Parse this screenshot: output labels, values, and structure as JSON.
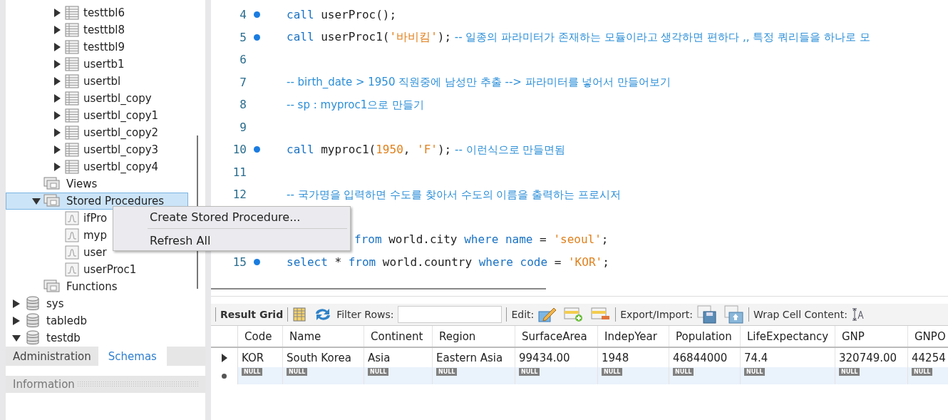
{
  "navigator": {
    "tables": [
      {
        "label": "testtbl6",
        "expanded": false
      },
      {
        "label": "testtbl8",
        "expanded": false
      },
      {
        "label": "testtbl9",
        "expanded": false
      },
      {
        "label": "usertb1",
        "expanded": false
      },
      {
        "label": "usertbl",
        "expanded": false
      },
      {
        "label": "usertbl_copy",
        "expanded": false
      },
      {
        "label": "usertbl_copy1",
        "expanded": false
      },
      {
        "label": "usertbl_copy2",
        "expanded": false
      },
      {
        "label": "usertbl_copy3",
        "expanded": false
      },
      {
        "label": "usertbl_copy4",
        "expanded": false
      }
    ],
    "objects": [
      {
        "label": "Views",
        "selected": false
      },
      {
        "label": "Stored Procedures",
        "selected": true,
        "expanded": true,
        "children": [
          {
            "label": "ifPro"
          },
          {
            "label": "myp"
          },
          {
            "label": "user"
          },
          {
            "label": "userProc1"
          }
        ]
      },
      {
        "label": "Functions",
        "selected": false
      }
    ],
    "databases": [
      {
        "label": "sys",
        "expanded": false
      },
      {
        "label": "tabledb",
        "expanded": false
      },
      {
        "label": "testdb",
        "expanded": true
      }
    ],
    "tabs": [
      {
        "label": "Administration",
        "selected": false
      },
      {
        "label": "Schemas",
        "selected": true
      }
    ],
    "info_header": "Information"
  },
  "context_menu": {
    "items": [
      "Create Stored Procedure...",
      "Refresh All"
    ]
  },
  "editor": {
    "lines": [
      {
        "number": "4",
        "marker": true,
        "tokens": [
          {
            "kind": "kw",
            "text": "call"
          },
          {
            "kind": "id",
            "text": " userProc();"
          }
        ]
      },
      {
        "number": "5",
        "marker": true,
        "tokens": [
          {
            "kind": "kw",
            "text": "call"
          },
          {
            "kind": "id",
            "text": " userProc1("
          },
          {
            "kind": "str",
            "text": "'바비킴'"
          },
          {
            "kind": "id",
            "text": ");"
          },
          {
            "kind": "cmt",
            "text": " -- 일종의 파라미터가 존재하는 모듈이라고 생각하면 편하다 ,, 특정 쿼리들을 하나로 모"
          }
        ]
      },
      {
        "number": "6",
        "marker": false
      },
      {
        "number": "7",
        "marker": false,
        "tokens": [
          {
            "kind": "cmt",
            "text": "-- birth_date > 1950 직원중에 남성만 추출  --> 파라미터를 넣어서 만들어보기"
          }
        ]
      },
      {
        "number": "8",
        "marker": false,
        "tokens": [
          {
            "kind": "cmt",
            "text": "-- sp : myproc1으로 만들기"
          }
        ]
      },
      {
        "number": "9",
        "marker": false
      },
      {
        "number": "10",
        "marker": true,
        "tokens": [
          {
            "kind": "kw",
            "text": "call"
          },
          {
            "kind": "id",
            "text": " myproc1("
          },
          {
            "kind": "num",
            "text": "1950"
          },
          {
            "kind": "id",
            "text": ", "
          },
          {
            "kind": "str",
            "text": "'F'"
          },
          {
            "kind": "id",
            "text": ");"
          },
          {
            "kind": "cmt",
            "text": " -- 이런식으로 만들면됨"
          }
        ]
      },
      {
        "number": "11",
        "marker": false
      },
      {
        "number": "12",
        "marker": false,
        "tokens": [
          {
            "kind": "cmt",
            "text": "-- 국가명을 입력하면 수도를 찾아서 수도의 이름을 출력하는 프로시저"
          }
        ]
      },
      {
        "tokens": [
          {
            "kind": "kw",
            "text": "from"
          },
          {
            "kind": "id",
            "text": " world.city "
          },
          {
            "kind": "kw",
            "text": "where"
          },
          {
            "kind": "kw",
            "text": " name"
          },
          {
            "kind": "id",
            "text": " = "
          },
          {
            "kind": "str",
            "text": "'seoul'"
          },
          {
            "kind": "id",
            "text": ";"
          }
        ]
      },
      {
        "number": "15",
        "marker": true,
        "tokens": [
          {
            "kind": "kw",
            "text": "select"
          },
          {
            "kind": "id",
            "text": " * "
          },
          {
            "kind": "kw",
            "text": "from"
          },
          {
            "kind": "id",
            "text": " world.country "
          },
          {
            "kind": "kw",
            "text": "where"
          },
          {
            "kind": "kw",
            "text": " code"
          },
          {
            "kind": "id",
            "text": " = "
          },
          {
            "kind": "str",
            "text": "'KOR'"
          },
          {
            "kind": "id",
            "text": ";"
          }
        ]
      }
    ]
  },
  "result": {
    "toolbar": {
      "title": "Result Grid",
      "filter_label": "Filter Rows:",
      "edit_label": "Edit:",
      "export_label": "Export/Import:",
      "wrap_label": "Wrap Cell Content:"
    },
    "columns": [
      "Code",
      "Name",
      "Continent",
      "Region",
      "SurfaceArea",
      "IndepYear",
      "Population",
      "LifeExpectancy",
      "GNP",
      "GNPO"
    ],
    "rows": [
      {
        "current": true,
        "cells": [
          "KOR",
          "South Korea",
          "Asia",
          "Eastern Asia",
          "99434.00",
          "1948",
          "46844000",
          "74.4",
          "320749.00",
          "44254"
        ]
      }
    ],
    "new_row": [
      "NULL",
      "NULL",
      "NULL",
      "NULL",
      "NULL",
      "NULL",
      "NULL",
      "NULL",
      "NULL",
      "NULL"
    ]
  }
}
